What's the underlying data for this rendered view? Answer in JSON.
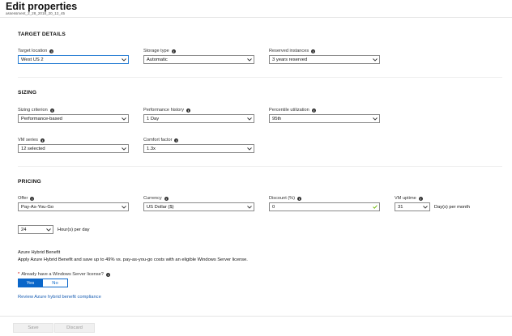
{
  "header": {
    "title": "Edit properties",
    "subtitle": "assessment_2_28_2018_20_12_45"
  },
  "target_details": {
    "heading": "TARGET DETAILS",
    "target_location": {
      "label": "Target location",
      "value": "West US 2"
    },
    "storage_type": {
      "label": "Storage type",
      "value": "Automatic"
    },
    "reserved_instances": {
      "label": "Reserved instances",
      "value": "3 years reserved"
    }
  },
  "sizing": {
    "heading": "SIZING",
    "sizing_criterion": {
      "label": "Sizing criterion",
      "value": "Performance-based"
    },
    "performance_history": {
      "label": "Performance history",
      "value": "1 Day"
    },
    "percentile_utilization": {
      "label": "Percentile utilization",
      "value": "95th"
    },
    "vm_series": {
      "label": "VM series",
      "value": "12 selected"
    },
    "comfort_factor": {
      "label": "Comfort factor",
      "value": "1.3x"
    }
  },
  "pricing": {
    "heading": "PRICING",
    "offer": {
      "label": "Offer",
      "value": "Pay-As-You-Go"
    },
    "currency": {
      "label": "Currency",
      "value": "US Dollar ($)"
    },
    "discount": {
      "label": "Discount (%)",
      "value": "0"
    },
    "vm_uptime": {
      "label": "VM uptime",
      "days_value": "31",
      "days_suffix": "Day(s) per month",
      "hours_value": "24",
      "hours_suffix": "Hour(s) per day"
    },
    "hybrid_benefit": {
      "title": "Azure Hybrid Benefit",
      "description": "Apply Azure Hybrid Benefit and save up to 49% vs. pay-as-you-go costs with an eligible Windows Server license.",
      "question_label": "Already have a Windows Server license?",
      "yes_label": "Yes",
      "no_label": "No",
      "selected": "Yes",
      "link_text": "Review Azure hybrid benefit compliance"
    }
  },
  "footer": {
    "save_label": "Save",
    "discard_label": "Discard"
  },
  "colors": {
    "accent": "#0a66c9",
    "link": "#1a5fb4",
    "valid_check": "#6bb700",
    "required": "#cc0000"
  },
  "icons": [
    "info-icon",
    "chevron-down-icon",
    "checkmark-icon"
  ]
}
